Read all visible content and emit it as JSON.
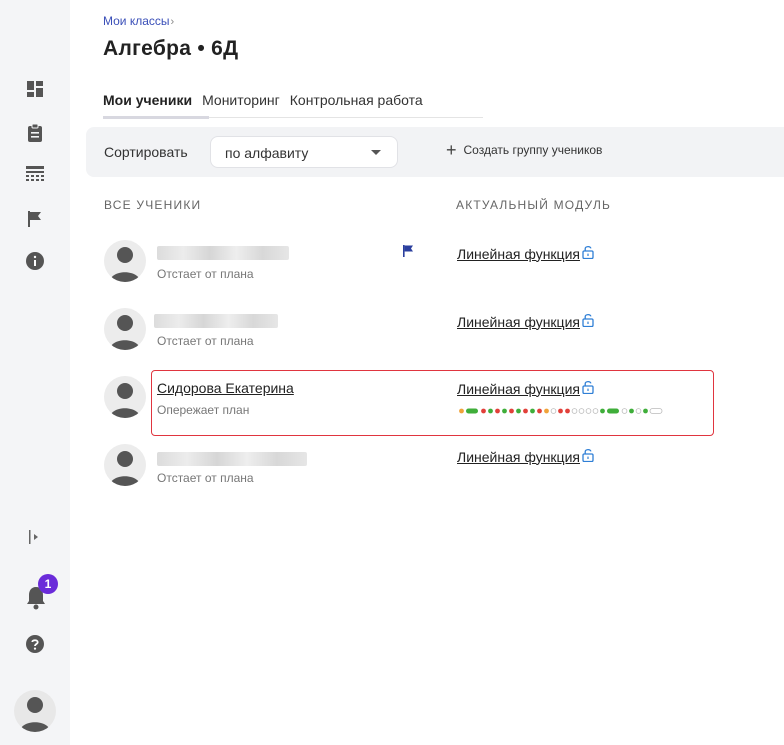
{
  "breadcrumb": {
    "parent": "Мои классы",
    "separator": "›"
  },
  "title": "Алгебра • 6Д",
  "tabs": [
    {
      "label": "Мои ученики",
      "active": true
    },
    {
      "label": "Мониторинг",
      "active": false
    },
    {
      "label": "Контрольная работа",
      "active": false
    }
  ],
  "toolbar": {
    "sort_label": "Сортировать",
    "sort_value": "по алфавиту",
    "create_group": "Создать группу учеников"
  },
  "columns": {
    "students": "ВСЕ УЧЕНИКИ",
    "module": "АКТУАЛЬНЫЙ МОДУЛЬ"
  },
  "students": [
    {
      "name_hidden": true,
      "status": "Отстает от плана",
      "module": "Линейная функция",
      "flag": true
    },
    {
      "name_hidden": true,
      "status": "Отстает от плана",
      "module": "Линейная функция",
      "flag": false
    },
    {
      "name": "Сидорова Екатерина",
      "status": "Опережает план",
      "module": "Линейная функция",
      "flag": false,
      "highlighted": true
    },
    {
      "name_hidden": true,
      "status": "Отстает от плана",
      "module": "Линейная функция",
      "flag": false
    }
  ],
  "notifications_count": "1",
  "colors": {
    "accent": "#3a4fb8",
    "highlight": "#e0353f",
    "badge": "#6a2bd9",
    "lock": "#2f7fd6"
  },
  "progress_dots": [
    "orange",
    "green-bar",
    "red",
    "green",
    "red",
    "green",
    "red",
    "green",
    "red",
    "green",
    "red",
    "orange",
    "empty",
    "red",
    "red",
    "empty",
    "empty",
    "empty",
    "empty",
    "green",
    "green-bar",
    "empty",
    "green",
    "empty",
    "green",
    "empty-bar"
  ]
}
